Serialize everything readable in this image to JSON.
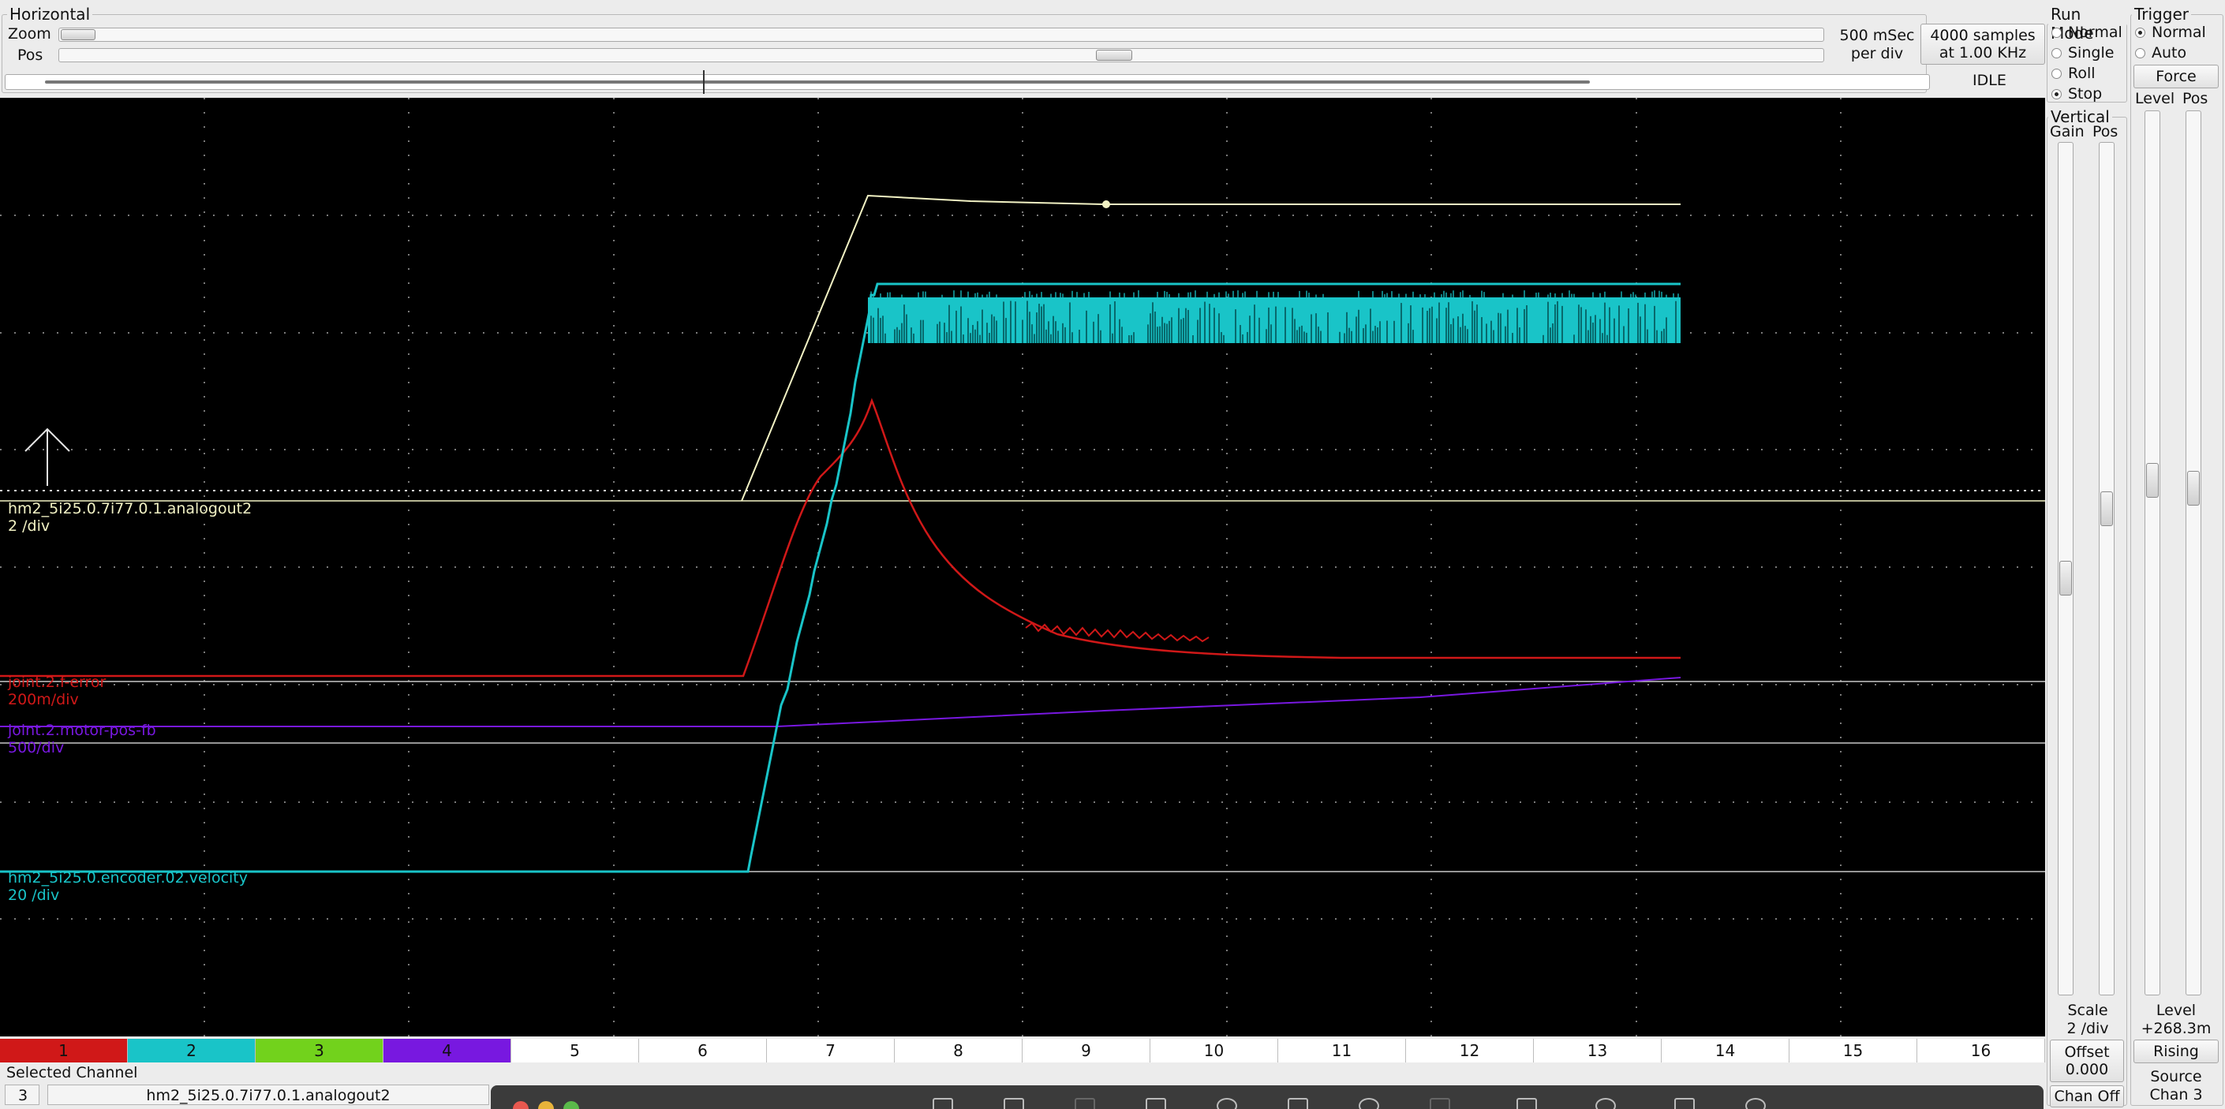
{
  "horizontal": {
    "title": "Horizontal",
    "zoom_label": "Zoom",
    "pos_label": "Pos",
    "rate_line1": "500 mSec",
    "rate_line2": "per div",
    "samples_line1": "4000 samples",
    "samples_line2": "at 1.00 KHz",
    "state": "IDLE",
    "zoom_fraction": 0.0,
    "pos_fraction": 0.59
  },
  "run_mode": {
    "title": "Run Mode",
    "options": [
      "Normal",
      "Single",
      "Roll",
      "Stop"
    ],
    "selected": "Stop"
  },
  "trigger": {
    "title": "Trigger",
    "options": [
      "Normal",
      "Auto"
    ],
    "selected": "Normal",
    "force_label": "Force",
    "level_label": "Level",
    "pos_label": "Pos",
    "level_caption": "Level",
    "level_value": "+268.3m",
    "edge": "Rising",
    "source_caption": "Source",
    "source_value": "Chan  3"
  },
  "vertical": {
    "title": "Vertical",
    "gain_label": "Gain",
    "pos_label": "Pos",
    "scale_caption": "Scale",
    "scale_value": "2 /div",
    "offset_caption": "Offset",
    "offset_value": "0.000",
    "chan_off_label": "Chan Off"
  },
  "traces": [
    {
      "name": "hm2_5i25.0.7i77.0.1.analogout2",
      "scale": "2 /div",
      "color": "#f2f2c4"
    },
    {
      "name": "joint.2.f-error",
      "scale": "200m/div",
      "color": "#d01818"
    },
    {
      "name": "joint.2.motor-pos-fb",
      "scale": "500/div",
      "color": "#7818e0"
    },
    {
      "name": "hm2_5i25.0.encoder.02.velocity",
      "scale": "20 /div",
      "color": "#19c4c8"
    }
  ],
  "channels": [
    {
      "label": "1",
      "color": "#d01818"
    },
    {
      "label": "2",
      "color": "#19c4c8"
    },
    {
      "label": "3",
      "color": "#72d21c"
    },
    {
      "label": "4",
      "color": "#7818e0"
    },
    {
      "label": "5",
      "color": "#ffffff"
    },
    {
      "label": "6",
      "color": "#ffffff"
    },
    {
      "label": "7",
      "color": "#ffffff"
    },
    {
      "label": "8",
      "color": "#ffffff"
    },
    {
      "label": "9",
      "color": "#ffffff"
    },
    {
      "label": "10",
      "color": "#ffffff"
    },
    {
      "label": "11",
      "color": "#ffffff"
    },
    {
      "label": "12",
      "color": "#ffffff"
    },
    {
      "label": "13",
      "color": "#ffffff"
    },
    {
      "label": "14",
      "color": "#ffffff"
    },
    {
      "label": "15",
      "color": "#ffffff"
    },
    {
      "label": "16",
      "color": "#ffffff"
    }
  ],
  "selected_channel": {
    "title": "Selected Channel",
    "number": "3",
    "name": "hm2_5i25.0.7i77.0.1.analogout2"
  },
  "colors": {
    "scope_bg": "#000000",
    "grid": "#7a7a7a"
  }
}
